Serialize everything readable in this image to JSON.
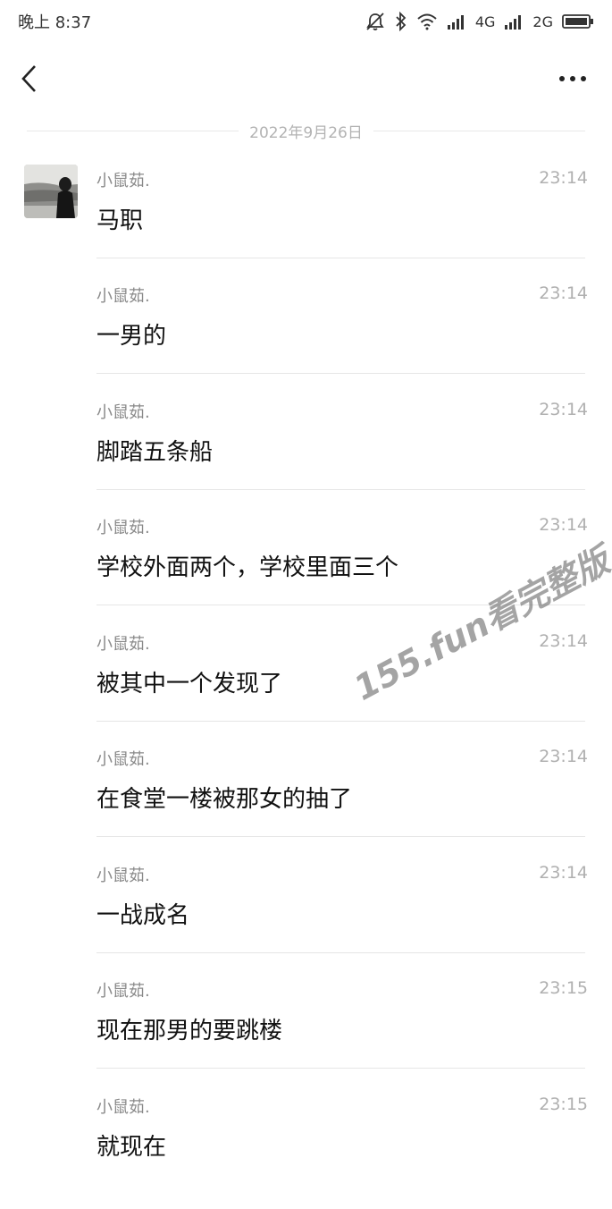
{
  "status_bar": {
    "time": "晚上 8:37",
    "network1": "4G",
    "network2": "2G"
  },
  "chat": {
    "date_separator": "2022年9月26日",
    "messages": [
      {
        "sender": "小鼠茹.",
        "time": "23:14",
        "text": "马职"
      },
      {
        "sender": "小鼠茹.",
        "time": "23:14",
        "text": "一男的"
      },
      {
        "sender": "小鼠茹.",
        "time": "23:14",
        "text": "脚踏五条船"
      },
      {
        "sender": "小鼠茹.",
        "time": "23:14",
        "text": "学校外面两个，学校里面三个"
      },
      {
        "sender": "小鼠茹.",
        "time": "23:14",
        "text": "被其中一个发现了"
      },
      {
        "sender": "小鼠茹.",
        "time": "23:14",
        "text": "在食堂一楼被那女的抽了"
      },
      {
        "sender": "小鼠茹.",
        "time": "23:14",
        "text": "一战成名"
      },
      {
        "sender": "小鼠茹.",
        "time": "23:15",
        "text": "现在那男的要跳楼"
      },
      {
        "sender": "小鼠茹.",
        "time": "23:15",
        "text": "就现在"
      }
    ]
  },
  "watermark": "155.fun看完整版",
  "icons": {
    "back": "chevron-left-icon",
    "more": "more-dots-icon",
    "mute": "bell-off-icon",
    "bluetooth": "bluetooth-icon",
    "wifi": "wifi-icon",
    "signal": "signal-icon",
    "battery": "battery-icon"
  }
}
